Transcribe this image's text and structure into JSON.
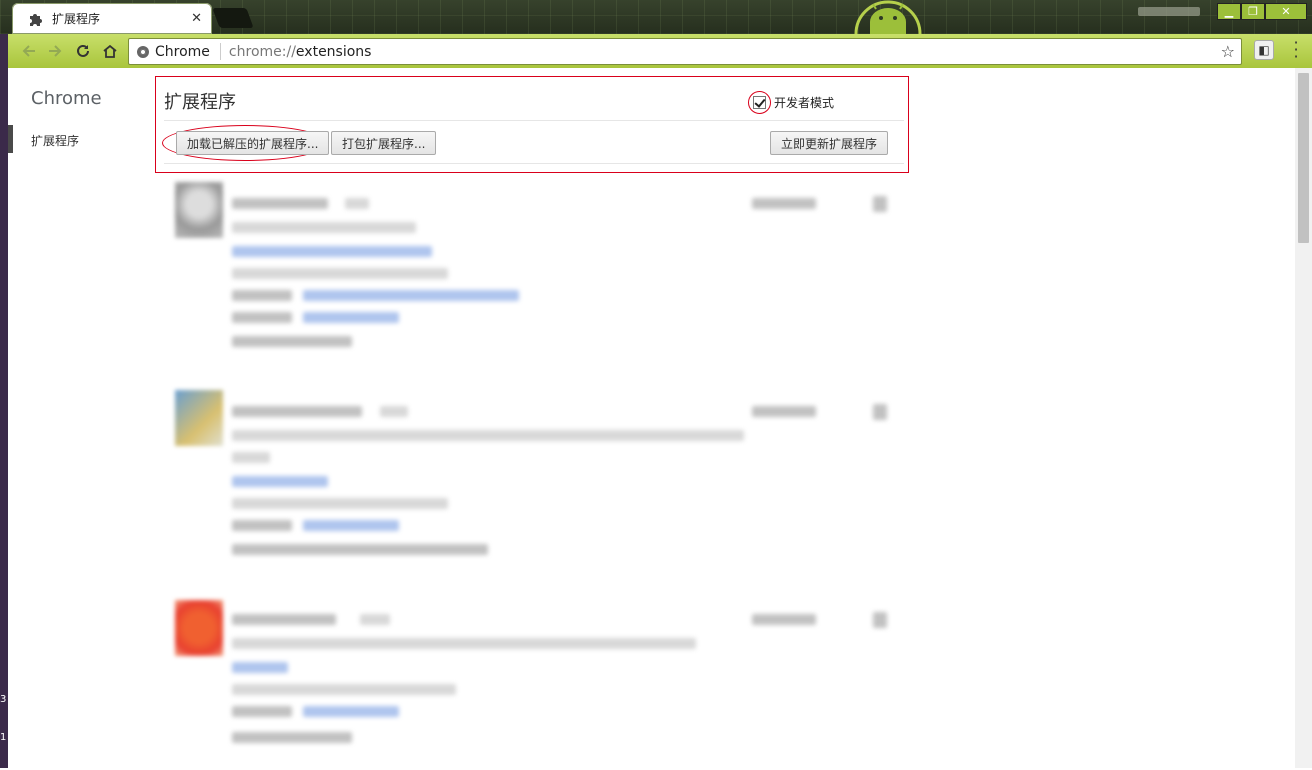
{
  "browser": {
    "tab_title": "扩展程序",
    "tab_close": "✕",
    "omnibox": {
      "chip_label": "Chrome",
      "url_scheme": "chrome://",
      "url_path": "extensions"
    },
    "window_controls": {
      "minimize": "▁",
      "maximize": "❐",
      "close": "✕"
    },
    "edge_digits": [
      "3",
      "1"
    ]
  },
  "sidebar": {
    "title": "Chrome",
    "items": [
      {
        "label": "扩展程序"
      }
    ]
  },
  "header": {
    "title": "扩展程序",
    "developer_mode_label": "开发者模式",
    "developer_mode_checked": true,
    "buttons": {
      "load_unpacked": "加载已解压的扩展程序...",
      "pack": "打包扩展程序...",
      "update_now": "立即更新扩展程序"
    }
  },
  "colors": {
    "annotation": "#d9001b",
    "toolbar": "#b6d04c",
    "link_blur": "#6d95e0"
  },
  "icons": [
    "puzzle-icon",
    "back-icon",
    "forward-icon",
    "reload-icon",
    "home-icon",
    "chrome-icon",
    "star-icon",
    "extension-icon",
    "menu-icon",
    "checkmark-icon"
  ]
}
